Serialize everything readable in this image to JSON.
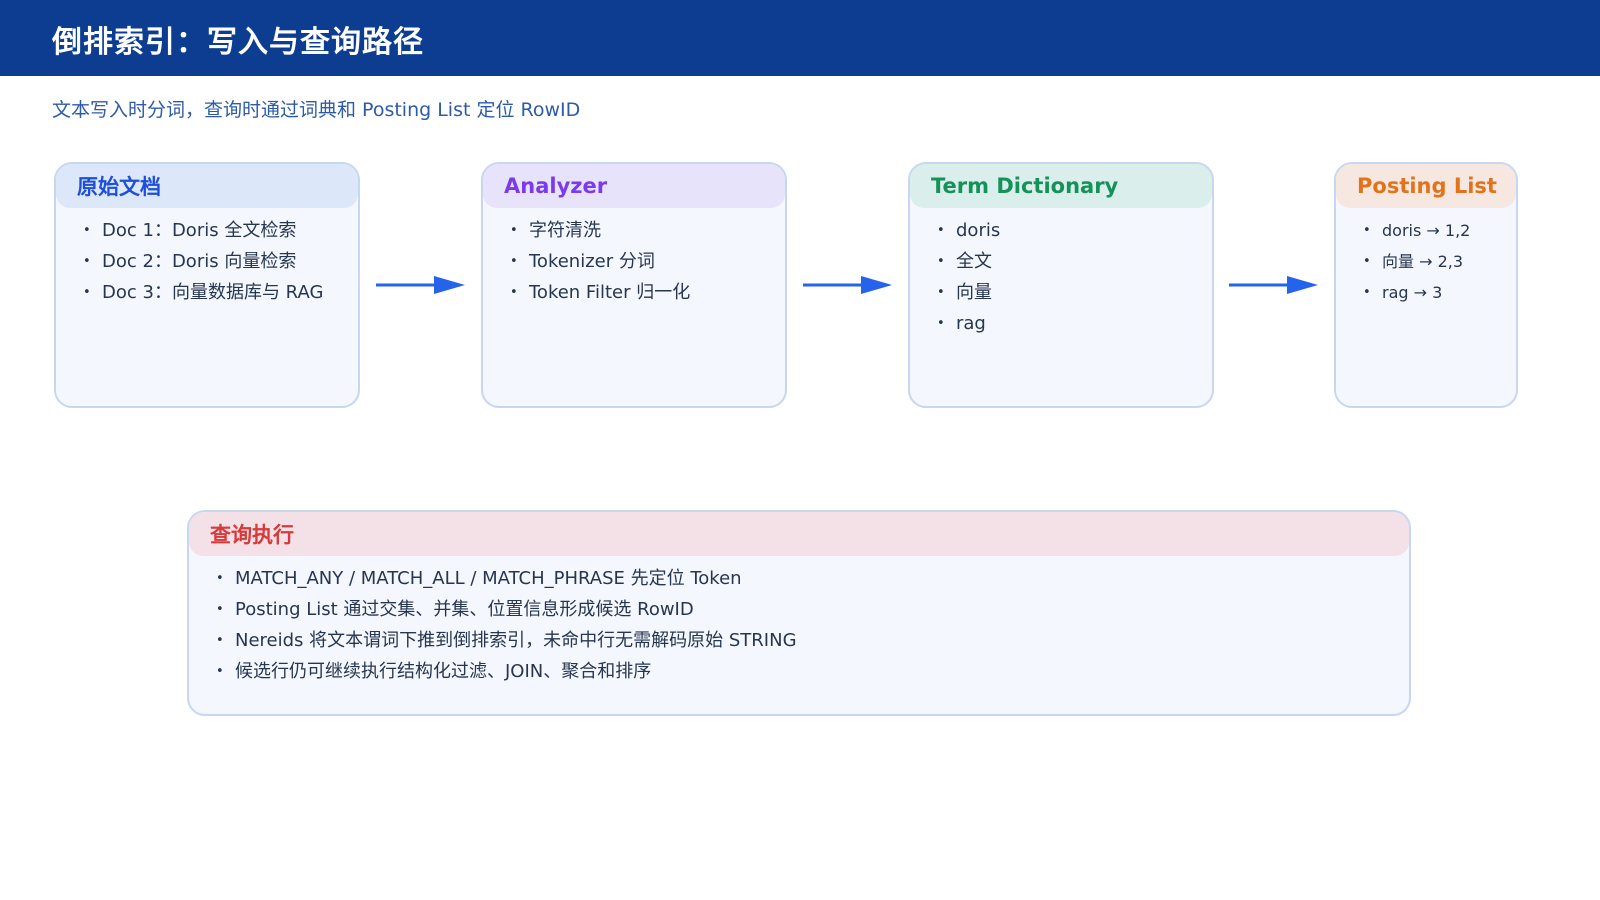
{
  "header": {
    "title": "倒排索引：写入与查询路径",
    "subtitle": "文本写入时分词，查询时通过词典和 Posting List 定位 RowID"
  },
  "colors": {
    "header_bg": "#0d3d91",
    "card_border": "#c7d7ef",
    "card_bg": "#f4f7fd",
    "arrow": "#2563eb"
  },
  "pipeline": [
    {
      "title": "原始文档",
      "title_color": "#1d4fd8",
      "head_bg": "#dde7fa",
      "items": [
        "Doc 1：Doris 全文检索",
        "Doc 2：Doris 向量检索",
        "Doc 3：向量数据库与 RAG"
      ]
    },
    {
      "title": "Analyzer",
      "title_color": "#7c3aed",
      "head_bg": "#e7e3fa",
      "items": [
        "字符清洗",
        "Tokenizer 分词",
        "Token Filter 归一化"
      ]
    },
    {
      "title": "Term Dictionary",
      "title_color": "#15915a",
      "head_bg": "#daeeec",
      "items": [
        "doris",
        "全文",
        "向量",
        "rag"
      ]
    },
    {
      "title": "Posting List",
      "title_color": "#e2731b",
      "head_bg": "#f6e8e0",
      "items": [
        "doris → 1,2",
        "向量 → 2,3",
        "rag → 3"
      ]
    }
  ],
  "query": {
    "title": "查询执行",
    "title_color": "#d63a3a",
    "head_bg": "#f3e1e7",
    "items": [
      "MATCH_ANY / MATCH_ALL / MATCH_PHRASE 先定位 Token",
      "Posting List 通过交集、并集、位置信息形成候选 RowID",
      "Nereids 将文本谓词下推到倒排索引，未命中行无需解码原始 STRING",
      "候选行仍可继续执行结构化过滤、JOIN、聚合和排序"
    ]
  }
}
